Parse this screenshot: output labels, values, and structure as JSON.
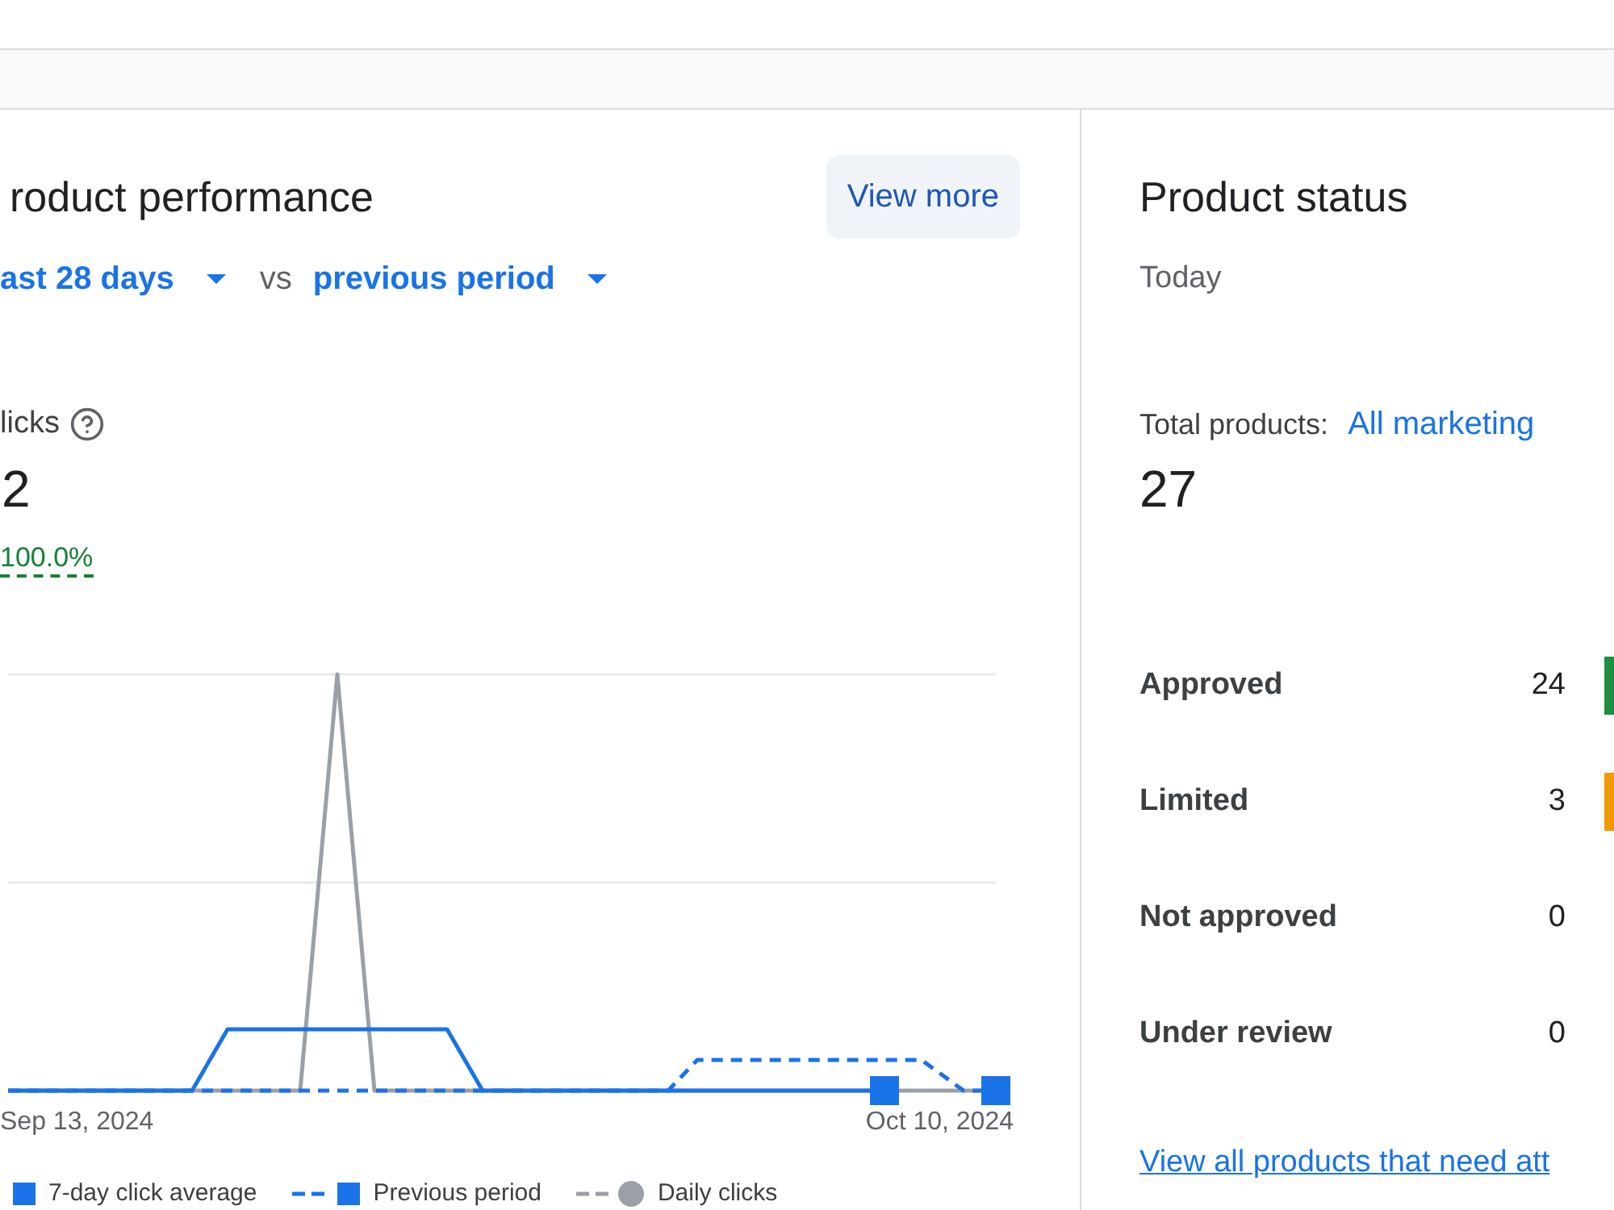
{
  "product_performance": {
    "title": "roduct performance",
    "view_more_button": "View more",
    "date_range": "ast 28 days",
    "comparison_word": "vs",
    "comparison": "previous period",
    "metric": {
      "label": "licks",
      "value": "2",
      "change": "100.0%"
    },
    "chart": {
      "x_labels": [
        "Sep 13, 2024",
        "Oct 10, 2024"
      ],
      "legend": [
        {
          "label": "7-day click average",
          "kind": "square",
          "color": "#1a73e8"
        },
        {
          "label": "Previous period",
          "kind": "dashsquare",
          "color": "#1a73e8"
        },
        {
          "label": "Daily clicks",
          "kind": "dashcircle",
          "color": "#9aa0a6"
        }
      ]
    }
  },
  "product_status": {
    "title": "Product status",
    "date": "Today",
    "total_label": "Total products:",
    "total_filter": "All marketing",
    "total": "27",
    "statuses": [
      {
        "label": "Approved",
        "count": "24",
        "color": "#1e8e3e"
      },
      {
        "label": "Limited",
        "count": "3",
        "color": "#f29900"
      },
      {
        "label": "Not approved",
        "count": "0"
      },
      {
        "label": "Under review",
        "count": "0"
      }
    ],
    "link": "View all products that need att"
  }
}
